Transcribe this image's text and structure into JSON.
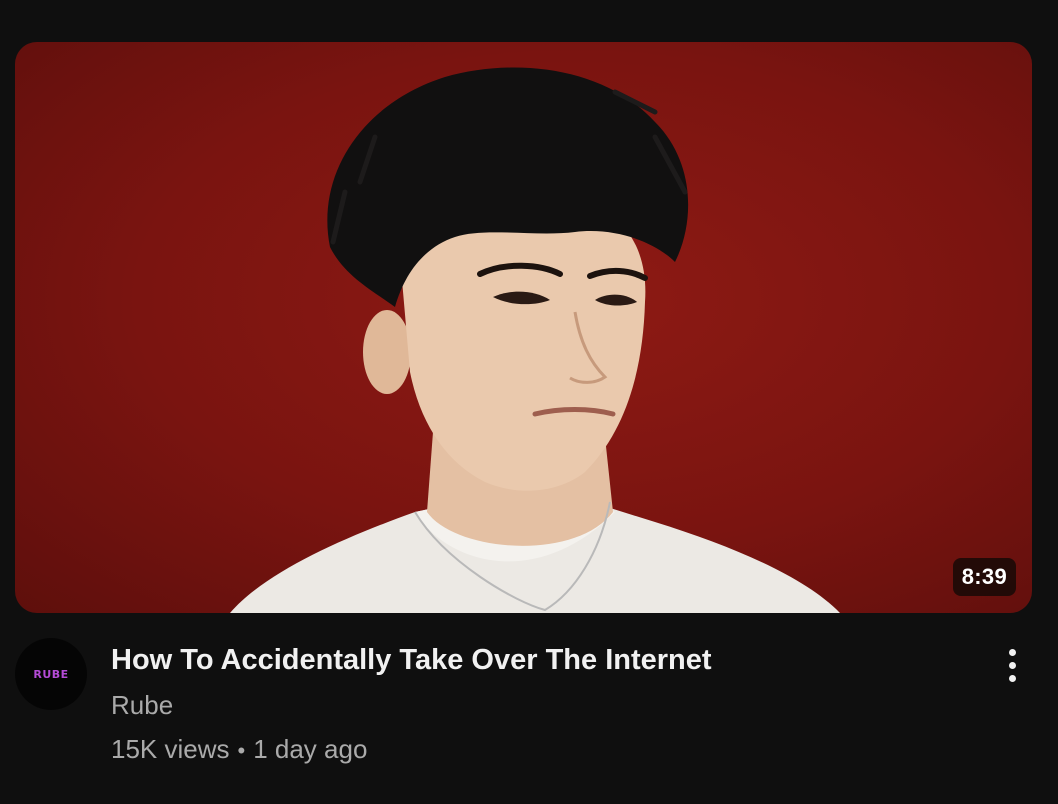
{
  "video": {
    "duration": "8:39",
    "title": "How To Accidentally Take Over The Internet",
    "channel": "Rube",
    "avatar_text": "RUBE",
    "views": "15K views",
    "separator": "•",
    "published": "1 day ago",
    "more_icon": "more-vertical-icon"
  },
  "colors": {
    "page_background": "#0f0f0f",
    "thumbnail_background": "#7a1410",
    "title": "#f1f1f1",
    "secondary_text": "#aaaaaa",
    "avatar_text": "#b44bd6"
  }
}
